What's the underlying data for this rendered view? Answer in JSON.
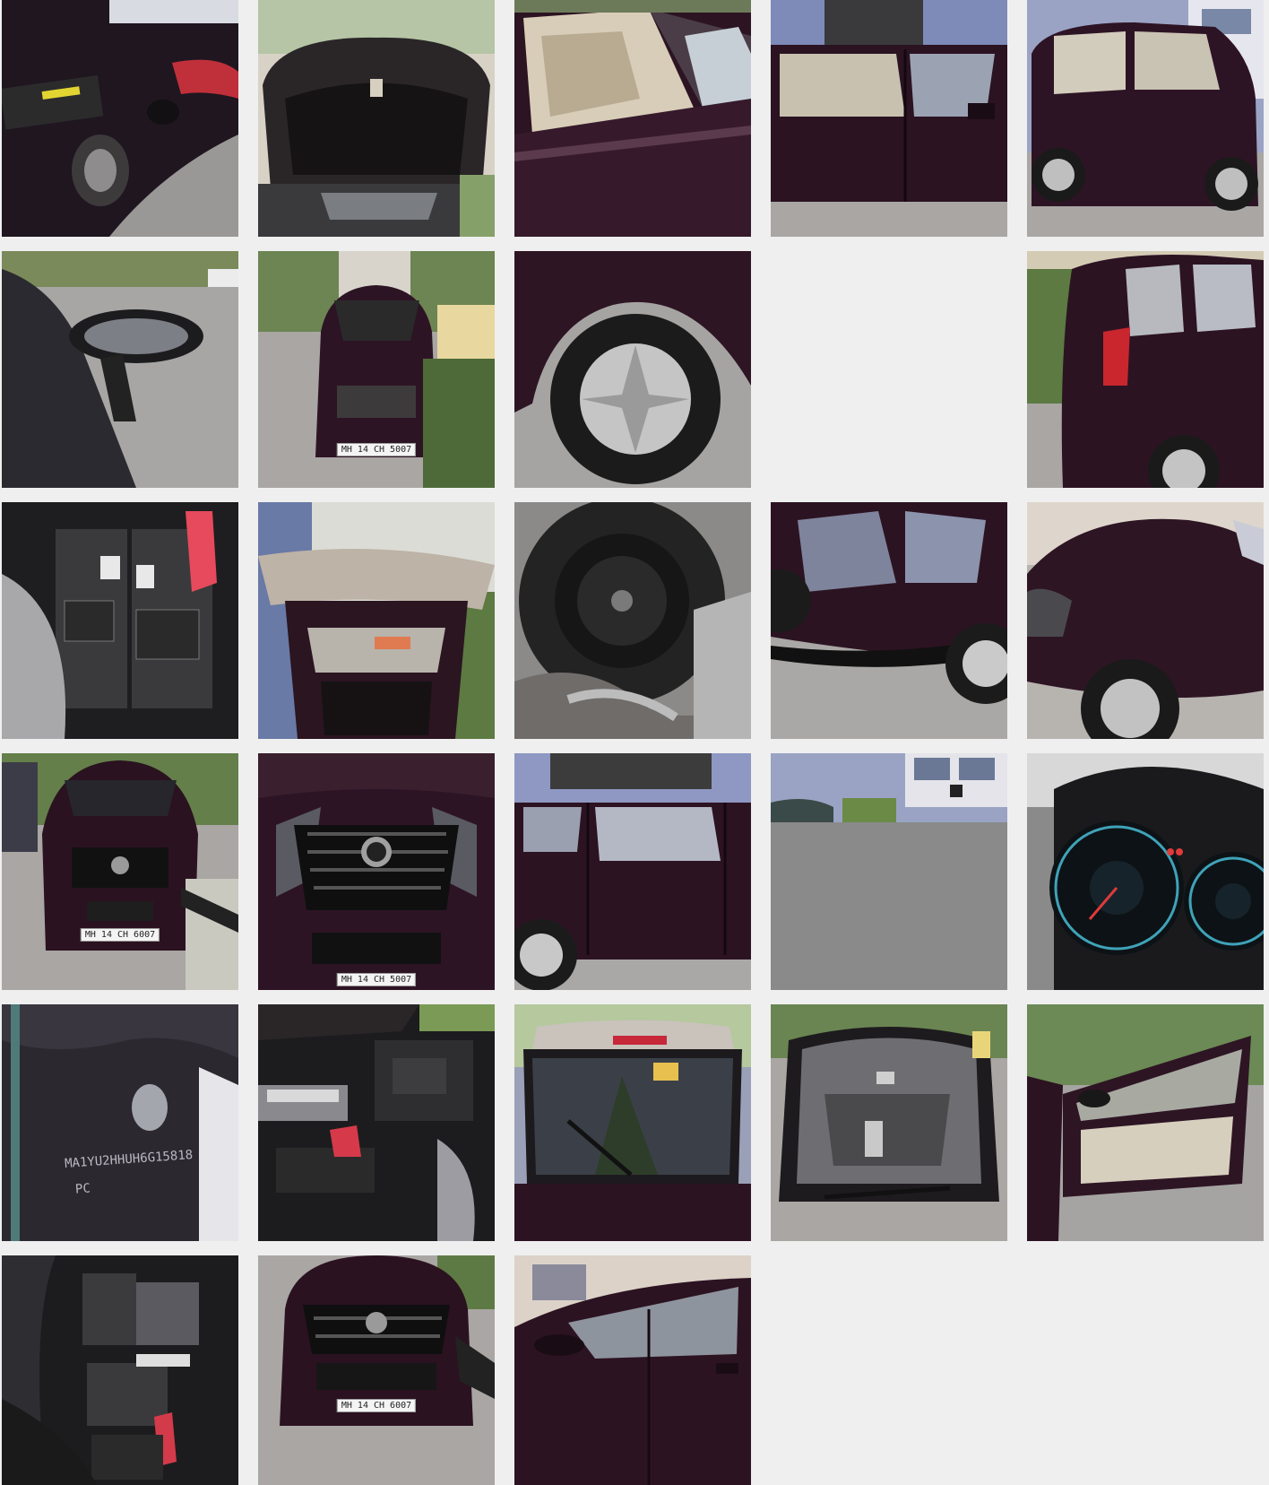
{
  "gallery": {
    "photos": [
      {
        "row": 1,
        "col": 1,
        "subject": "fuel-lid"
      },
      {
        "row": 1,
        "col": 2,
        "subject": "bonnet-underside"
      },
      {
        "row": 1,
        "col": 3,
        "subject": "front-door-mirror"
      },
      {
        "row": 1,
        "col": 4,
        "subject": "side-doors"
      },
      {
        "row": 1,
        "col": 5,
        "subject": "side-view"
      },
      {
        "row": 2,
        "col": 1,
        "subject": "wing-mirror"
      },
      {
        "row": 2,
        "col": 2,
        "subject": "front-view",
        "plate_text": "MH 14 CH 5007"
      },
      {
        "row": 2,
        "col": 3,
        "subject": "front-wheel"
      },
      {
        "row": 2,
        "col": 4,
        "subject": "empty"
      },
      {
        "row": 2,
        "col": 5,
        "subject": "rear-quarter"
      },
      {
        "row": 3,
        "col": 1,
        "subject": "battery"
      },
      {
        "row": 3,
        "col": 2,
        "subject": "tailgate-open"
      },
      {
        "row": 3,
        "col": 3,
        "subject": "spare-wheel"
      },
      {
        "row": 3,
        "col": 4,
        "subject": "side-panel"
      },
      {
        "row": 3,
        "col": 5,
        "subject": "front-fender"
      },
      {
        "row": 4,
        "col": 1,
        "subject": "front-view",
        "plate_text": "MH 14 CH 6007"
      },
      {
        "row": 4,
        "col": 2,
        "subject": "grille",
        "plate_text": "MH 14 CH 5007"
      },
      {
        "row": 4,
        "col": 3,
        "subject": "rear-door"
      },
      {
        "row": 4,
        "col": 4,
        "subject": "partial-image"
      },
      {
        "row": 4,
        "col": 5,
        "subject": "instrument-cluster"
      },
      {
        "row": 5,
        "col": 1,
        "subject": "chassis-number",
        "vin_text": "MA1YU2HHUH6G15818",
        "vin_suffix": "PC"
      },
      {
        "row": 5,
        "col": 2,
        "subject": "engine-bay"
      },
      {
        "row": 5,
        "col": 3,
        "subject": "rear-windshield"
      },
      {
        "row": 5,
        "col": 4,
        "subject": "front-windshield"
      },
      {
        "row": 5,
        "col": 5,
        "subject": "door-open"
      },
      {
        "row": 6,
        "col": 1,
        "subject": "engine-closeup"
      },
      {
        "row": 6,
        "col": 2,
        "subject": "front-view",
        "plate_text": "MH 14 CH 6007"
      },
      {
        "row": 6,
        "col": 3,
        "subject": "front-door"
      }
    ]
  },
  "colors": {
    "background": "#efefef",
    "car_body": "#2e1524",
    "road": "#a9a6a4",
    "wall": "#9aa3c4",
    "foliage": "#5f7a45",
    "placeholder_grey": "#8a8a8a"
  }
}
